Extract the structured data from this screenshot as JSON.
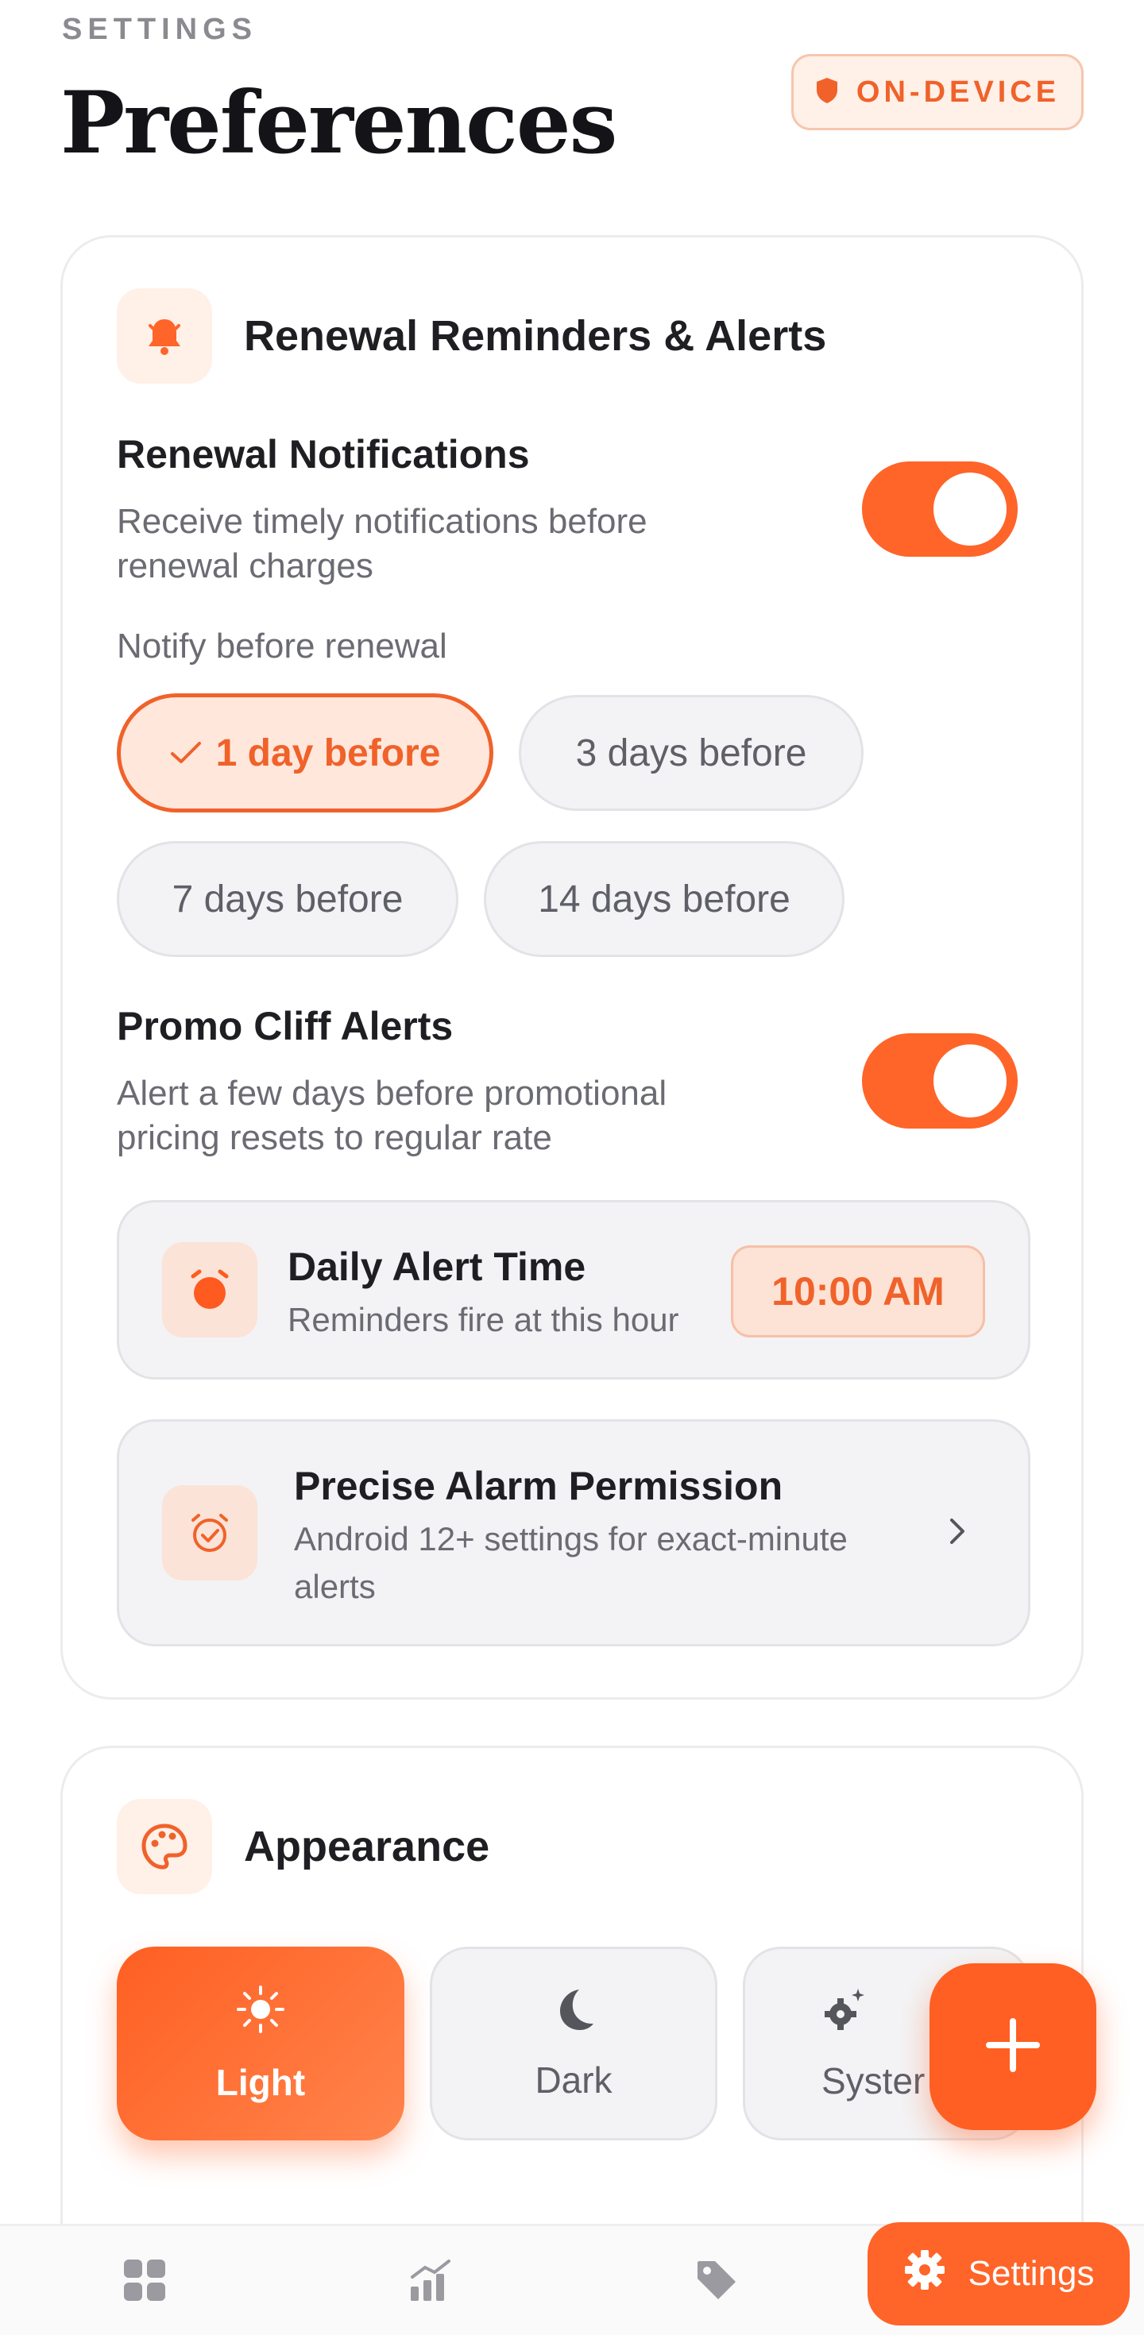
{
  "header": {
    "eyebrow": "SETTINGS",
    "title": "Preferences",
    "badge": "ON-DEVICE"
  },
  "reminders": {
    "section_title": "Renewal Reminders & Alerts",
    "renewal_notifications": {
      "title": "Renewal Notifications",
      "desc_line1": "Receive timely notifications before",
      "desc_line2": "renewal charges",
      "enabled": true
    },
    "notify_label": "Notify before renewal",
    "options": [
      {
        "label": "1 day before",
        "selected": true
      },
      {
        "label": "3 days before",
        "selected": false
      },
      {
        "label": "7 days before",
        "selected": false
      },
      {
        "label": "14 days before",
        "selected": false
      }
    ],
    "promo": {
      "title": "Promo Cliff Alerts",
      "desc_line1": "Alert a few days before promotional",
      "desc_line2": "pricing resets to regular rate",
      "enabled": true
    },
    "daily_time": {
      "title": "Daily Alert Time",
      "desc": "Reminders fire at this hour",
      "value": "10:00 AM"
    },
    "alarm": {
      "title": "Precise Alarm Permission",
      "desc_line1": "Android 12+ settings for exact-minute",
      "desc_line2": "alerts"
    }
  },
  "appearance": {
    "section_title": "Appearance",
    "themes": [
      {
        "label": "Light",
        "icon": "sun-icon",
        "selected": true
      },
      {
        "label": "Dark",
        "icon": "moon-icon",
        "selected": false
      },
      {
        "label": "Syster",
        "icon": "gears-icon",
        "selected": false
      }
    ]
  },
  "tabbar": {
    "active_label": "Settings",
    "items": [
      "grid-icon",
      "chart-icon",
      "tag-icon",
      "gear-icon"
    ]
  },
  "colors": {
    "accent": "#ff6429",
    "accent_soft": "#fff0e8",
    "text": "#1f1f23",
    "muted": "#6b6b73"
  }
}
